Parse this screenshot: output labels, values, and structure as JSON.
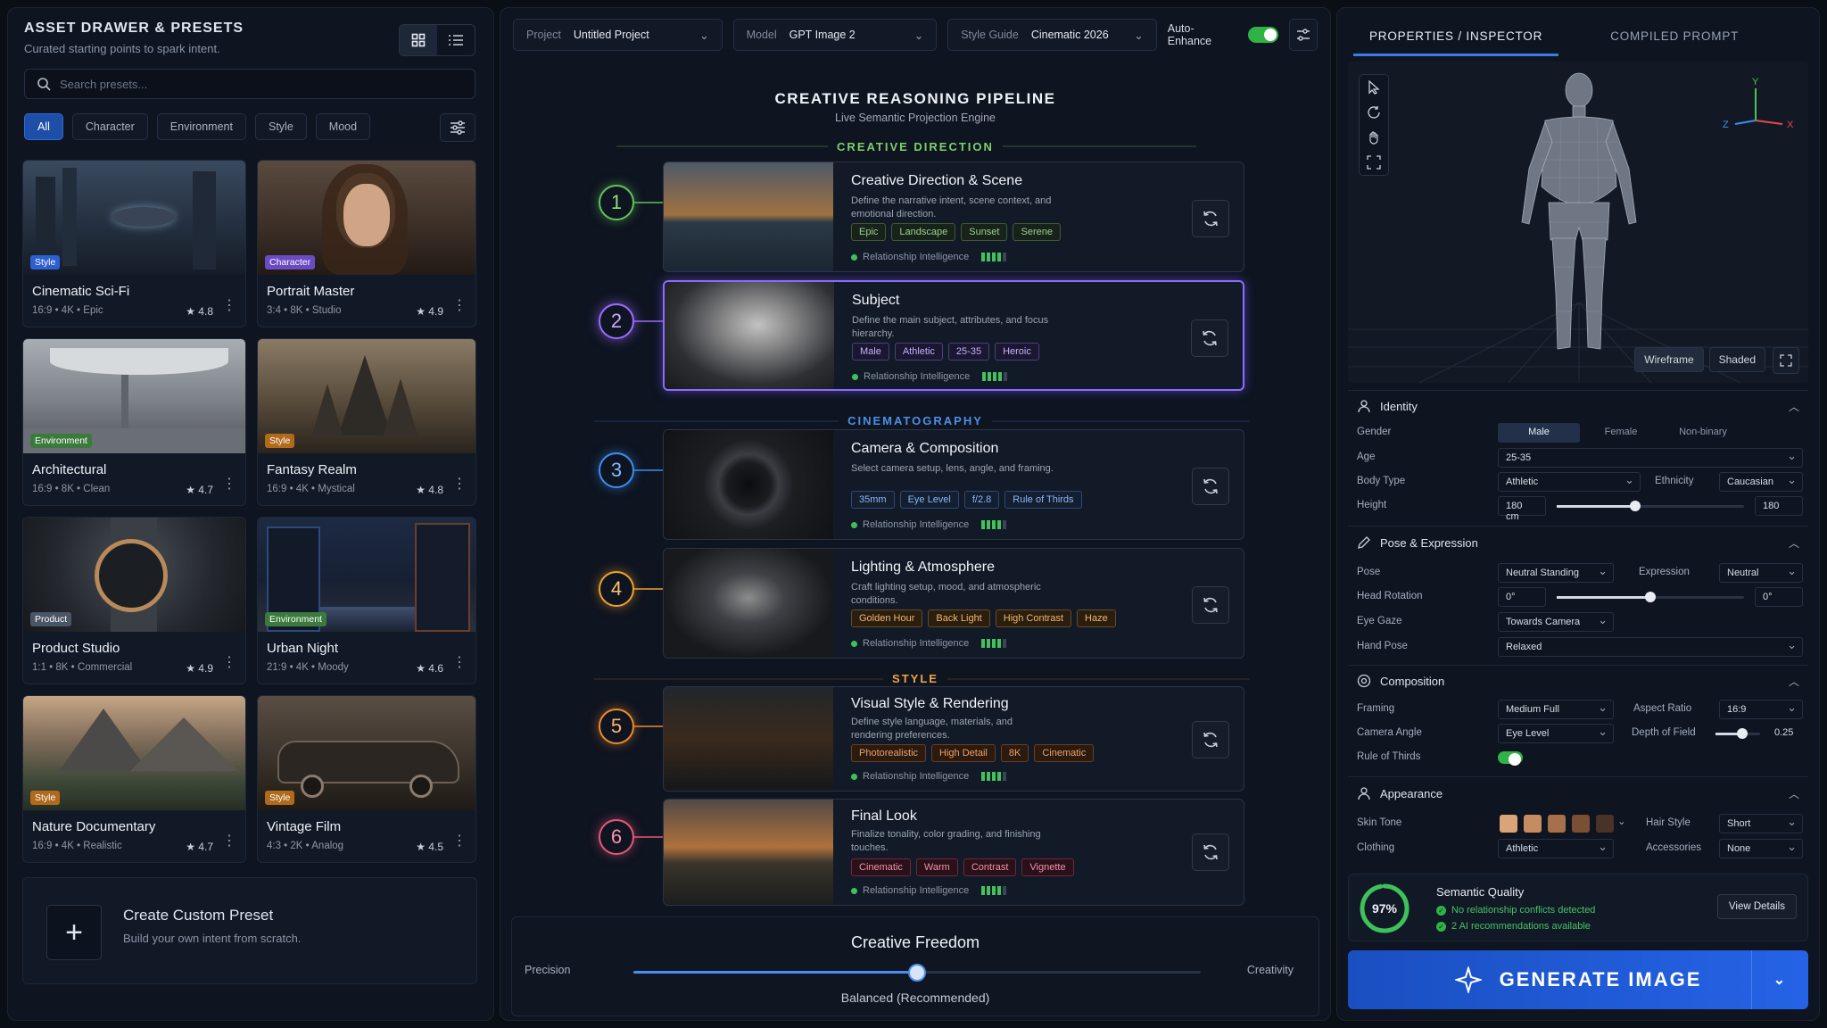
{
  "left": {
    "title": "ASSET DRAWER & PRESETS",
    "subtitle": "Curated starting points to spark intent.",
    "search_placeholder": "Search presets...",
    "filters": [
      "All",
      "Character",
      "Environment",
      "Style",
      "Mood"
    ],
    "presets": [
      {
        "name": "Cinematic Sci-Fi",
        "tag": "Style",
        "tag_color": "#2d5fd0",
        "meta": "16:9  •  4K  •  Epic",
        "rating": "★ 4.8"
      },
      {
        "name": "Portrait Master",
        "tag": "Character",
        "tag_color": "#6b4bc4",
        "meta": "3:4  •  8K  •  Studio",
        "rating": "★ 4.9"
      },
      {
        "name": "Architectural",
        "tag": "Environment",
        "tag_color": "#3b7a3c",
        "meta": "16:9  •  8K  •  Clean",
        "rating": "★ 4.7"
      },
      {
        "name": "Fantasy Realm",
        "tag": "Style",
        "tag_color": "#b06a1c",
        "meta": "16:9  •  4K  •  Mystical",
        "rating": "★ 4.8"
      },
      {
        "name": "Product Studio",
        "tag": "Product",
        "tag_color": "#4a5566",
        "meta": "1:1  •  8K  •  Commercial",
        "rating": "★ 4.9"
      },
      {
        "name": "Urban Night",
        "tag": "Environment",
        "tag_color": "#3b7a3c",
        "meta": "21:9  •  4K  •  Moody",
        "rating": "★ 4.6"
      },
      {
        "name": "Nature Documentary",
        "tag": "Style",
        "tag_color": "#b06a1c",
        "meta": "16:9  •  4K  •  Realistic",
        "rating": "★ 4.7"
      },
      {
        "name": "Vintage Film",
        "tag": "Style",
        "tag_color": "#b06a1c",
        "meta": "4:3  •  2K  •  Analog",
        "rating": "★ 4.5"
      }
    ],
    "create_title": "Create Custom Preset",
    "create_sub": "Build your own intent from scratch."
  },
  "topbar": {
    "project_label": "Project",
    "project_value": "Untitled Project",
    "model_label": "Model",
    "model_value": "GPT Image 2",
    "style_label": "Style Guide",
    "style_value": "Cinematic 2026",
    "auto_label": "Auto-Enhance"
  },
  "pipeline": {
    "title": "CREATIVE REASONING PIPELINE",
    "subtitle": "Live Semantic Projection Engine",
    "sections": [
      "CREATIVE DIRECTION",
      "CINEMATOGRAPHY",
      "STYLE"
    ],
    "ri_label": "Relationship Intelligence",
    "stages": [
      {
        "n": "1",
        "title": "Creative Direction & Scene",
        "desc": "Define the narrative intent, scene context, and emotional direction.",
        "tags": [
          "Epic",
          "Landscape",
          "Sunset",
          "Serene"
        ],
        "color": "#5fc45a"
      },
      {
        "n": "2",
        "title": "Subject",
        "desc": "Define the main subject, attributes, and focus hierarchy.",
        "tags": [
          "Male",
          "Athletic",
          "25-35",
          "Heroic"
        ],
        "color": "#9b6cff"
      },
      {
        "n": "3",
        "title": "Camera & Composition",
        "desc": "Select camera setup, lens, angle, and framing.",
        "tags": [
          "35mm",
          "Eye Level",
          "f/2.8",
          "Rule of Thirds"
        ],
        "color": "#3b8ef0"
      },
      {
        "n": "4",
        "title": "Lighting & Atmosphere",
        "desc": "Craft lighting setup, mood, and atmospheric conditions.",
        "tags": [
          "Golden Hour",
          "Back Light",
          "High Contrast",
          "Haze"
        ],
        "color": "#f0a02f"
      },
      {
        "n": "5",
        "title": "Visual Style & Rendering",
        "desc": "Define style language, materials, and rendering preferences.",
        "tags": [
          "Photorealistic",
          "High Detail",
          "8K",
          "Cinematic"
        ],
        "color": "#f08a2a"
      },
      {
        "n": "6",
        "title": "Final Look",
        "desc": "Finalize tonality, color grading, and finishing touches.",
        "tags": [
          "Cinematic",
          "Warm",
          "Contrast",
          "Vignette"
        ],
        "color": "#e8567a"
      }
    ],
    "freedom_title": "Creative Freedom",
    "freedom_left": "Precision",
    "freedom_right": "Creativity",
    "freedom_value_label": "Balanced (Recommended)",
    "freedom_level": 0.5
  },
  "right": {
    "tabs": [
      "PROPERTIES / INSPECTOR",
      "COMPILED PROMPT"
    ],
    "axes": {
      "y": "Y",
      "z": "Z",
      "x": "X"
    },
    "mode_wire": "Wireframe",
    "mode_shaded": "Shaded",
    "identity": {
      "title": "Identity",
      "gender_label": "Gender",
      "genders": [
        "Male",
        "Female",
        "Non-binary"
      ],
      "age_label": "Age",
      "age": "25-35",
      "body_label": "Body Type",
      "body": "Athletic",
      "eth_label": "Ethnicity",
      "eth": "Caucasian",
      "height_label": "Height",
      "height_min": "180 cm",
      "height_val": "180",
      "height_level": 0.42
    },
    "pose": {
      "title": "Pose & Expression",
      "pose_label": "Pose",
      "pose": "Neutral Standing",
      "expr_label": "Expression",
      "expr": "Neutral",
      "head_label": "Head Rotation",
      "head_min": "0°",
      "head_val": "0°",
      "head_level": 0.5,
      "gaze_label": "Eye Gaze",
      "gaze": "Towards Camera",
      "hand_label": "Hand Pose",
      "hand": "Relaxed"
    },
    "composition": {
      "title": "Composition",
      "framing_label": "Framing",
      "framing": "Medium Full",
      "ar_label": "Aspect Ratio",
      "ar": "16:9",
      "angle_label": "Camera Angle",
      "angle": "Eye Level",
      "dof_label": "Depth of Field",
      "dof": "0.25",
      "dof_level": 0.6,
      "rot_label": "Rule of Thirds"
    },
    "appearance": {
      "title": "Appearance",
      "skin_label": "Skin Tone",
      "skin": [
        "#d9a47a",
        "#c78b62",
        "#a8704a",
        "#7a4f33",
        "#4a3326"
      ],
      "hair_label": "Hair Style",
      "hair": "Short",
      "cloth_label": "Clothing",
      "cloth": "Athletic",
      "acc_label": "Accessories",
      "acc": "None"
    },
    "quality": {
      "pct": "97%",
      "level": 0.97,
      "title": "Semantic Quality",
      "i1": "No relationship conflicts detected",
      "i2": "2 AI recommendations available",
      "btn": "View Details"
    },
    "generate": "GENERATE IMAGE"
  }
}
